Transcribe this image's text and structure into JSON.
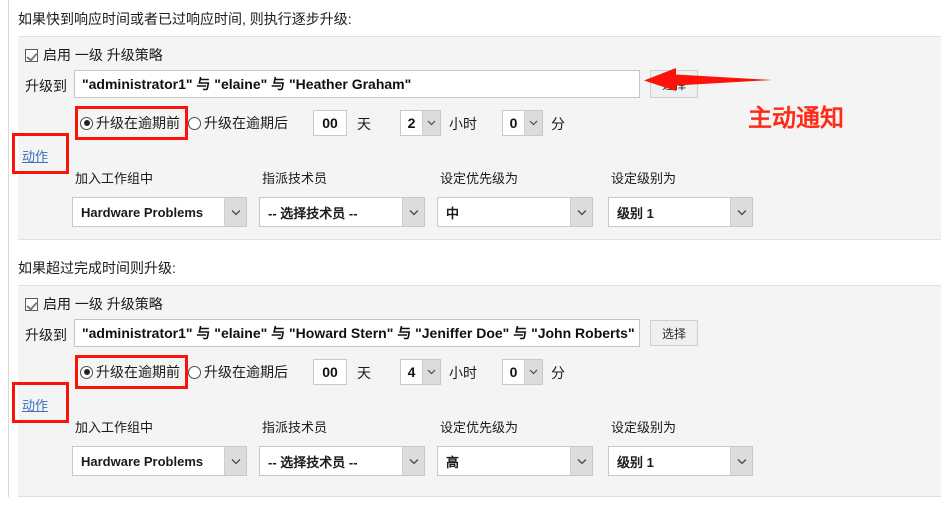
{
  "sections": [
    {
      "title": "如果快到响应时间或者已过响应时间, 则执行逐步升级:",
      "enable_checkbox_label": "启用 一级 升级策略",
      "escalate_label": "升级到",
      "escalate_value": "\"administrator1\" 与 \"elaine\" 与 \"Heather Graham\"",
      "select_button": "选择",
      "radio_before": "升级在逾期前",
      "radio_after": "升级在逾期后",
      "days_value": "00",
      "days_unit": "天",
      "hours_value": "2",
      "hours_unit": "小时",
      "minutes_value": "0",
      "minutes_unit": "分",
      "action_link": "动作",
      "columns": [
        {
          "label": "加入工作组中",
          "value": "Hardware Problems"
        },
        {
          "label": "指派技术员",
          "value": "-- 选择技术员 --"
        },
        {
          "label": "设定优先级为",
          "value": "中"
        },
        {
          "label": "设定级别为",
          "value": "级别 1"
        }
      ]
    },
    {
      "title": "如果超过完成时间则升级:",
      "enable_checkbox_label": "启用 一级 升级策略",
      "escalate_label": "升级到",
      "escalate_value": "\"administrator1\" 与 \"elaine\" 与 \"Howard Stern\" 与 \"Jeniffer Doe\" 与 \"John Roberts\"",
      "select_button": "选择",
      "radio_before": "升级在逾期前",
      "radio_after": "升级在逾期后",
      "days_value": "00",
      "days_unit": "天",
      "hours_value": "4",
      "hours_unit": "小时",
      "minutes_value": "0",
      "minutes_unit": "分",
      "action_link": "动作",
      "columns": [
        {
          "label": "加入工作组中",
          "value": "Hardware Problems"
        },
        {
          "label": "指派技术员",
          "value": "-- 选择技术员 --"
        },
        {
          "label": "设定优先级为",
          "value": "高"
        },
        {
          "label": "设定级别为",
          "value": "级别 1"
        }
      ]
    }
  ],
  "annotations": {
    "callout_text": "主动通知",
    "highlight_color": "#fb1208",
    "callout_color": "#ff2b16"
  }
}
